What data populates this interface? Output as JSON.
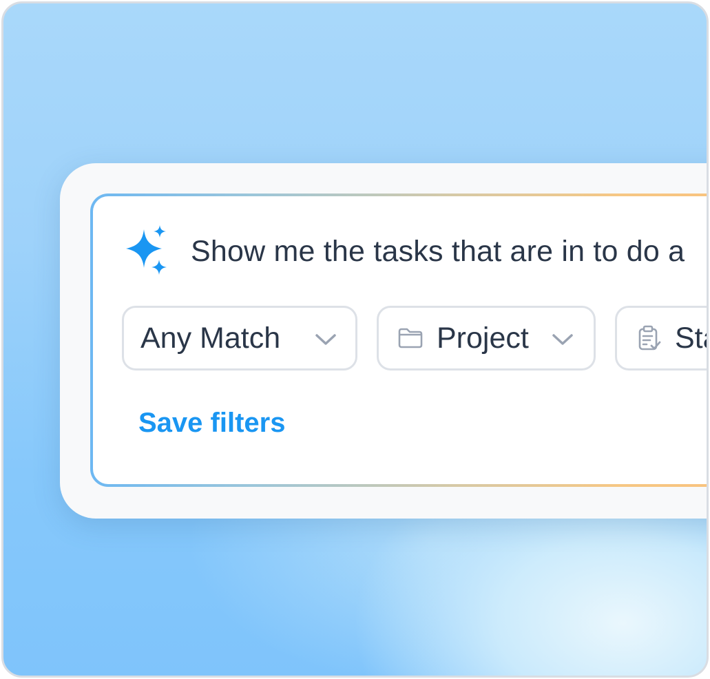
{
  "query": {
    "text": "Show me the tasks that are in to do a"
  },
  "filters": [
    {
      "label": "Any Match",
      "icon": "chevron-down-icon"
    },
    {
      "label": "Project",
      "icon": "folder-icon"
    },
    {
      "label": "Sta",
      "icon": "clipboard-check-icon"
    }
  ],
  "actions": {
    "save_filters": "Save filters"
  },
  "colors": {
    "accent": "#1a96f2",
    "text": "#2a3648",
    "chip_border": "#dde1e7",
    "icon_gray": "#9aa3b2"
  }
}
